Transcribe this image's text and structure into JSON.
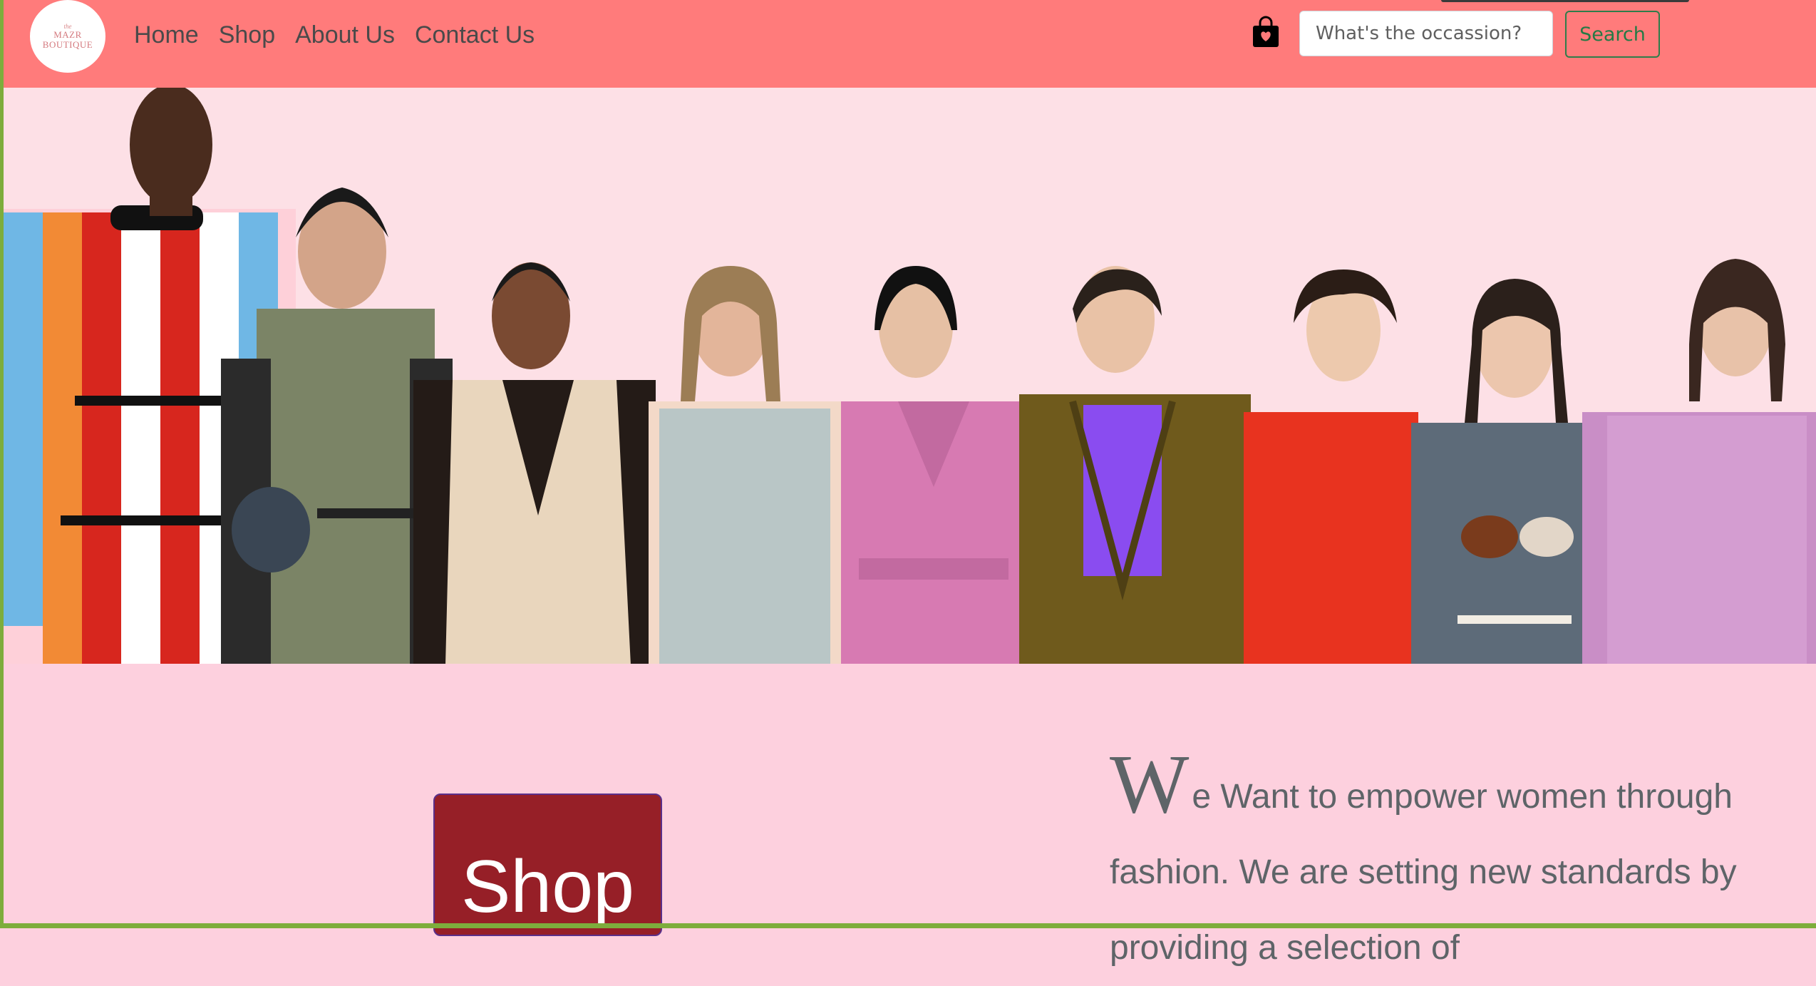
{
  "navbar": {
    "logo": {
      "line_top": "the",
      "line1": "MAZR",
      "line2": "BOUTIQUE"
    },
    "links": [
      {
        "label": "Home"
      },
      {
        "label": "Shop"
      },
      {
        "label": "About Us"
      },
      {
        "label": "Contact Us"
      }
    ],
    "cart_icon": "shopping-bag-icon",
    "search": {
      "placeholder": "What's the occassion?",
      "value": "",
      "button_label": "Search"
    }
  },
  "hero": {
    "image_description_icon": "runway-models-banner",
    "models": [
      {
        "outfit": "striped-dress",
        "color": "#d7261e"
      },
      {
        "outfit": "olive-vest",
        "color": "#7b8466"
      },
      {
        "outfit": "suede-vest",
        "color": "#e9d6bd"
      },
      {
        "outfit": "sequin-top",
        "color": "#b9c6c6"
      },
      {
        "outfit": "pink-wrap-suit",
        "color": "#d77ab2"
      },
      {
        "outfit": "olive-blazer",
        "color": "#6f5a1c"
      },
      {
        "outfit": "red-dress",
        "color": "#e8331f"
      },
      {
        "outfit": "grey-sweater",
        "color": "#5d6b79"
      },
      {
        "outfit": "lilac-pleated",
        "color": "#c98ec6"
      }
    ]
  },
  "cta": {
    "shop_label": "Shop"
  },
  "mission": {
    "dropcap": "W",
    "text": "e Want to empower women through fashion. We are setting new standards by providing a selection of"
  },
  "colors": {
    "navbar_bg": "#ff7b7b",
    "page_bg": "#fdd0de",
    "hero_bg": "#fde0e6",
    "shop_button_bg": "#961f27",
    "search_button_text": "#247a45",
    "frame_accent": "#7dad3c"
  }
}
